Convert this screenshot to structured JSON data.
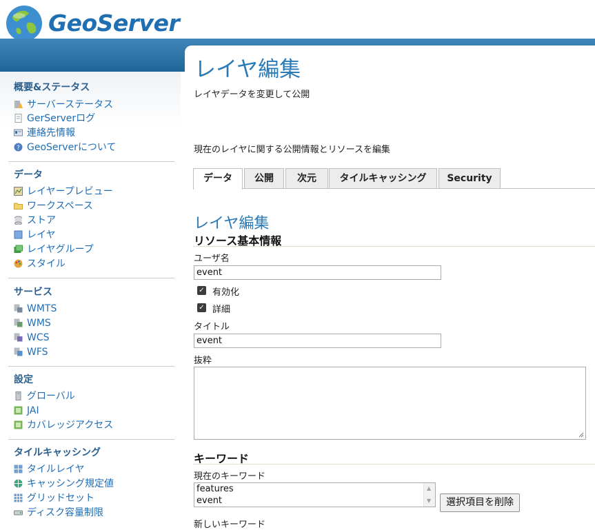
{
  "brand": {
    "name": "GeoServer"
  },
  "sidebar": {
    "sections": [
      {
        "title": "概要&ステータス",
        "items": [
          {
            "label": "サーバーステータス",
            "icon": "server-status-icon"
          },
          {
            "label": "GerServerログ",
            "icon": "log-file-icon"
          },
          {
            "label": "連絡先情報",
            "icon": "contact-card-icon"
          },
          {
            "label": "GeoServerについて",
            "icon": "info-icon"
          }
        ]
      },
      {
        "title": "データ",
        "items": [
          {
            "label": "レイヤープレビュー",
            "icon": "layer-preview-icon"
          },
          {
            "label": "ワークスペース",
            "icon": "folder-icon"
          },
          {
            "label": "ストア",
            "icon": "store-icon"
          },
          {
            "label": "レイヤ",
            "icon": "layer-icon"
          },
          {
            "label": "レイヤグループ",
            "icon": "layer-group-icon"
          },
          {
            "label": "スタイル",
            "icon": "palette-icon"
          }
        ]
      },
      {
        "title": "サービス",
        "items": [
          {
            "label": "WMTS",
            "icon": "wmts-icon"
          },
          {
            "label": "WMS",
            "icon": "wms-icon"
          },
          {
            "label": "WCS",
            "icon": "wcs-icon"
          },
          {
            "label": "WFS",
            "icon": "wfs-icon"
          }
        ]
      },
      {
        "title": "設定",
        "items": [
          {
            "label": "グローバル",
            "icon": "global-settings-icon"
          },
          {
            "label": "JAI",
            "icon": "jai-icon"
          },
          {
            "label": "カバレッジアクセス",
            "icon": "coverage-access-icon"
          }
        ]
      },
      {
        "title": "タイルキャッシング",
        "items": [
          {
            "label": "タイルレイヤ",
            "icon": "tile-layers-icon"
          },
          {
            "label": "キャッシング規定値",
            "icon": "caching-defaults-icon"
          },
          {
            "label": "グリッドセット",
            "icon": "gridset-icon"
          },
          {
            "label": "ディスク容量制限",
            "icon": "disk-quota-icon"
          }
        ]
      }
    ]
  },
  "main": {
    "title": "レイヤ編集",
    "description": "レイヤデータを変更して公開",
    "description2": "現在のレイヤに関する公開情報とリソースを編集",
    "tabs": [
      {
        "label": "データ",
        "active": true
      },
      {
        "label": "公開"
      },
      {
        "label": "次元"
      },
      {
        "label": "タイルキャッシング"
      },
      {
        "label": "Security"
      }
    ],
    "subtitle": "レイヤ編集",
    "basic_info": {
      "heading": "リソース基本情報",
      "name_label": "ユーザ名",
      "name_value": "event",
      "enabled_label": "有効化",
      "advertised_label": "詳細",
      "title_label": "タイトル",
      "title_value": "event",
      "abstract_label": "抜粋"
    },
    "keywords": {
      "heading": "キーワード",
      "current_label": "現在のキーワード",
      "items": [
        "features",
        "event"
      ],
      "remove_button": "選択項目を削除",
      "new_label": "新しいキーワード"
    }
  },
  "colors": {
    "accent": "#2a7ab6",
    "header_bar": "#1e6699",
    "link": "#1e6db5"
  }
}
